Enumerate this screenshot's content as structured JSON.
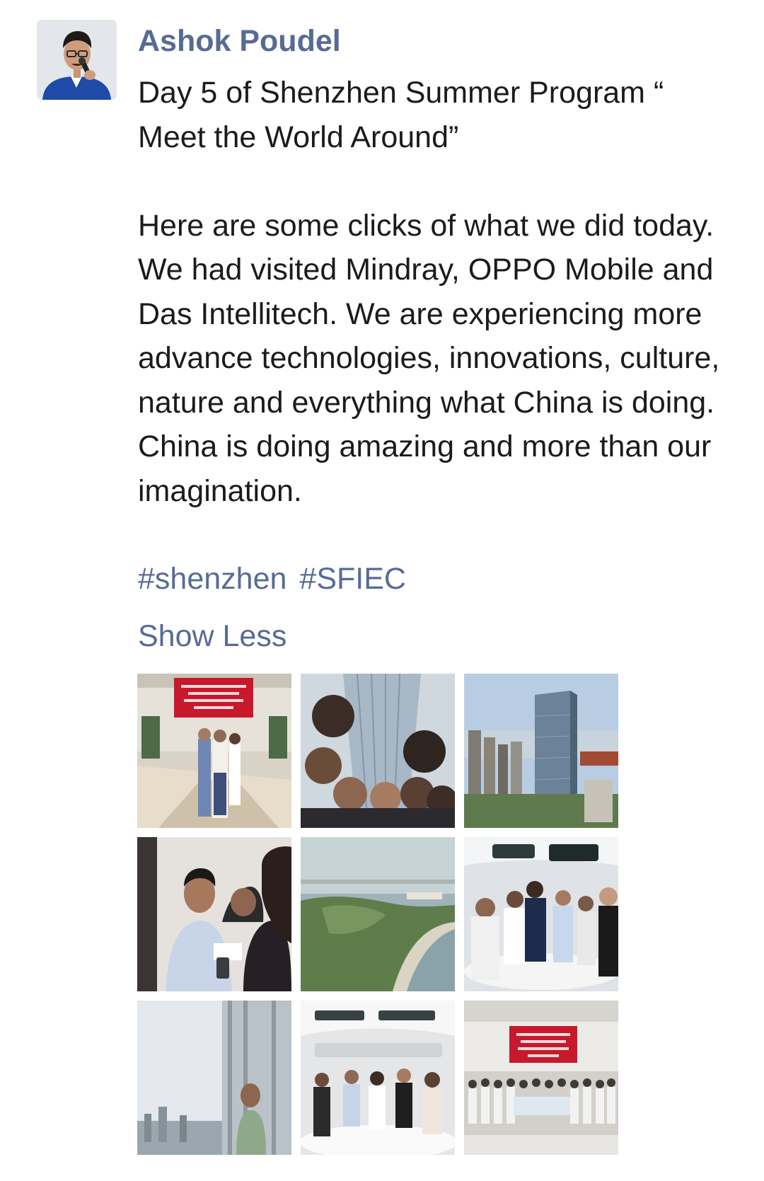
{
  "post": {
    "author": "Ashok Poudel",
    "text": "Day 5 of Shenzhen Summer Program “\nMeet the World Around”\n\nHere are some clicks of what we did today. We had visited Mindray, OPPO Mobile and Das Intellitech. We are experiencing more advance technologies, innovations, culture, nature and everything what China is doing. China is doing amazing and more than our imagination.",
    "hashtags": [
      "#shenzhen",
      "#SFIEC"
    ],
    "show_less_label": "Show Less"
  },
  "colors": {
    "link": "#576b95",
    "text": "#1b1b1b",
    "background": "#ffffff"
  }
}
